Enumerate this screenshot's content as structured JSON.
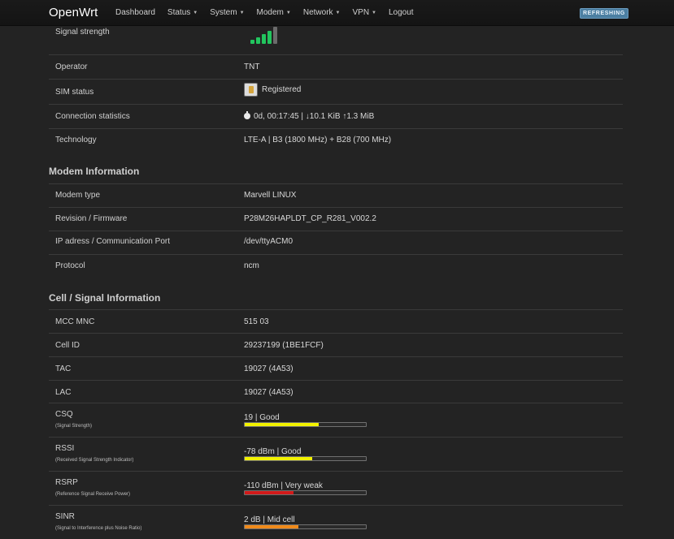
{
  "header": {
    "brand": "OpenWrt",
    "nav": [
      {
        "label": "Dashboard",
        "caret": false
      },
      {
        "label": "Status",
        "caret": true
      },
      {
        "label": "System",
        "caret": true
      },
      {
        "label": "Modem",
        "caret": true
      },
      {
        "label": "Network",
        "caret": true
      },
      {
        "label": "VPN",
        "caret": true
      },
      {
        "label": "Logout",
        "caret": false
      }
    ],
    "refresh_badge": "REFRESHING"
  },
  "connection": {
    "signal_strength": {
      "label": "Signal strength",
      "level_bars": 4,
      "total_bars": 5
    },
    "operator": {
      "label": "Operator",
      "value": "TNT"
    },
    "sim_status": {
      "label": "SIM status",
      "value": "Registered",
      "icon": "sim-card-icon"
    },
    "stats": {
      "label": "Connection statistics",
      "value": "0d, 00:17:45 | ↓10.1 KiB ↑1.3 MiB",
      "icon": "stopwatch-icon"
    },
    "technology": {
      "label": "Technology",
      "value": "LTE-A | B3 (1800 MHz) + B28 (700 MHz)"
    }
  },
  "modem_info": {
    "title": "Modem Information",
    "rows": [
      {
        "label": "Modem type",
        "value": "Marvell LINUX"
      },
      {
        "label": "Revision / Firmware",
        "value": "P28M26HAPLDT_CP_R281_V002.2"
      },
      {
        "label": "IP adress / Communication Port",
        "value": "/dev/ttyACM0"
      },
      {
        "label": "Protocol",
        "value": "ncm"
      }
    ]
  },
  "cell_info": {
    "title": "Cell / Signal Information",
    "rows": [
      {
        "label": "MCC MNC",
        "value": "515 03"
      },
      {
        "label": "Cell ID",
        "value": "29237199 (1BE1FCF)"
      },
      {
        "label": "TAC",
        "value": "19027 (4A53)"
      },
      {
        "label": "LAC",
        "value": "19027 (4A53)"
      }
    ],
    "meters": [
      {
        "label": "CSQ",
        "sublabel": "(Signal Strength)",
        "value": "19 | Good",
        "fraction": 0.61,
        "color": "#f2f200"
      },
      {
        "label": "RSSI",
        "sublabel": "(Received Signal Strength Indicator)",
        "value": "-78 dBm | Good",
        "fraction": 0.56,
        "color": "#f2f200"
      },
      {
        "label": "RSRP",
        "sublabel": "(Reference Signal Receive Power)",
        "value": "-110 dBm | Very weak",
        "fraction": 0.4,
        "color": "#d21a1a"
      },
      {
        "label": "SINR",
        "sublabel": "(Signal to Interference plus Noise Ratio)",
        "value": "2 dB | Mid cell",
        "fraction": 0.44,
        "color": "#f08a1a"
      }
    ]
  },
  "colors": {
    "signal_active": "#22c55e",
    "signal_inactive": "#6b6b6b",
    "background": "#232323",
    "navbar": "#161616"
  }
}
